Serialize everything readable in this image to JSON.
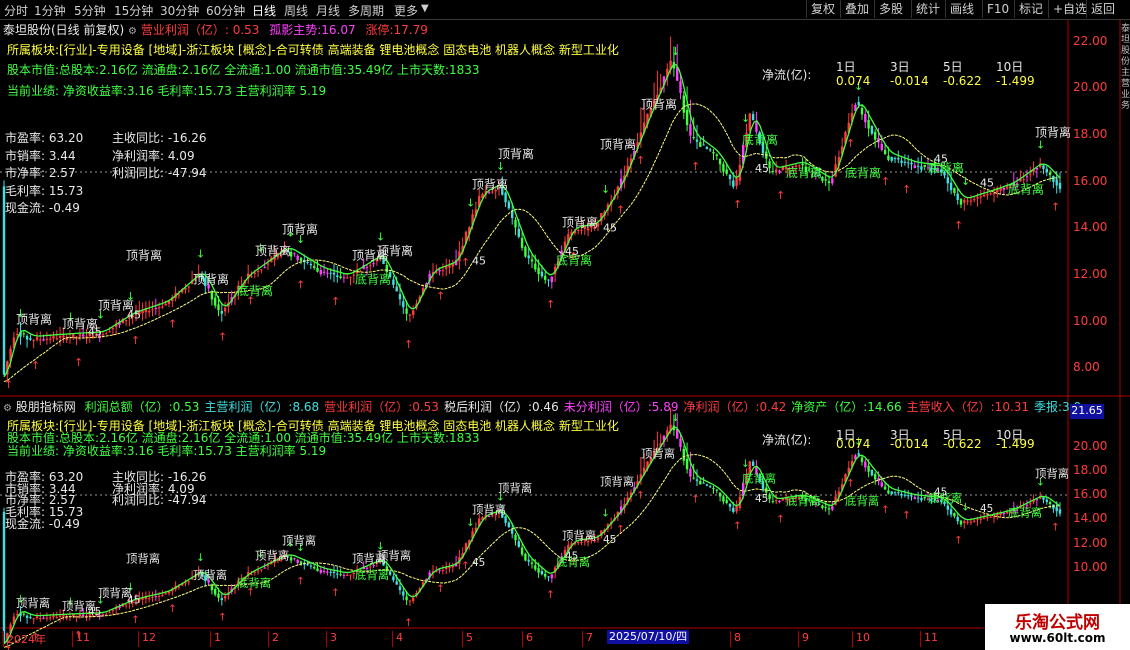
{
  "toolbar": {
    "periods": [
      "分时",
      "1分钟",
      "5分钟",
      "15分钟",
      "30分钟",
      "60分钟",
      "日线",
      "周线",
      "月线",
      "多周期",
      "更多"
    ],
    "active": "日线",
    "right_buttons": [
      "复权",
      "叠加",
      "多股",
      "统计",
      "画线",
      "F10",
      "标记",
      "+自选",
      "返回"
    ]
  },
  "top_header": {
    "title": "泰坦股份(日线 前复权)",
    "indicator1_label": "营业利润（亿）:",
    "indicator1_value": "0.53",
    "indicator2": "孤影主势:16.07",
    "indicator3": "涨停:17.79"
  },
  "info": {
    "sector_line": "所属板块:[行业]-专用设备 [地域]-浙江板块 [概念]-合可转债 高端装备 锂电池概念 固态电池 机器人概念 新型工业化",
    "capital_line": "股本市值:总股本:2.16亿 流通盘:2.16亿 全流通:1.00 流通市值:35.49亿 上市天数:1833",
    "perf_line": "当前业绩: 净资收益率:3.16 毛利率:15.73 主营利润率 5.19"
  },
  "metrics_left": [
    "市盈率: 63.20",
    "市销率: 3.44",
    "市净率: 2.57",
    "毛利率: 15.73",
    "现金流: -0.49"
  ],
  "metrics_right": [
    "主收同比: -16.26",
    "净利润率: 4.09",
    "利润同比: -47.94"
  ],
  "netflow": {
    "label": "净流(亿):",
    "headers": [
      "1日",
      "3日",
      "5日",
      "10日"
    ],
    "values": [
      "0.074",
      "-0.014",
      "-0.622",
      "-1.499"
    ]
  },
  "top_yaxis": [
    "22.00",
    "20.00",
    "18.00",
    "16.00",
    "14.00",
    "12.00",
    "10.00",
    "8.00"
  ],
  "bottom_yaxis": [
    "20.00",
    "18.00",
    "16.00",
    "14.00",
    "12.00",
    "10.00"
  ],
  "bottom_header": {
    "title": "股朋指标网",
    "items": [
      {
        "t": "利润总额（亿）:0.53",
        "c": "#40ff40"
      },
      {
        "t": "主营利润（亿）:8.68",
        "c": "#40e0e0"
      },
      {
        "t": "营业利润（亿）:0.53",
        "c": "#ff3c3c"
      },
      {
        "t": "税后利润（亿）:0.46",
        "c": "#e8e8e8"
      },
      {
        "t": "未分利润（亿）:5.89",
        "c": "#ff40ff"
      },
      {
        "t": "净利润（亿）:0.42",
        "c": "#ff3c3c"
      },
      {
        "t": "净资产（亿）:14.66",
        "c": "#40ff40"
      },
      {
        "t": "主营收入（亿）:10.31",
        "c": "#ff3c3c"
      },
      {
        "t": "季报:3.0",
        "c": "#40e0e0"
      }
    ],
    "price_box": "21.65"
  },
  "chart_labels": {
    "top_divergence": "顶背离",
    "bottom_divergence": "底背离",
    "angle": "45"
  },
  "xaxis": {
    "labels": [
      "2024年",
      "11",
      "12",
      "1",
      "2",
      "3",
      "4",
      "5",
      "6",
      "7",
      "8",
      "9",
      "10",
      "11",
      "12"
    ],
    "cursor_date": "2025/07/10/四"
  },
  "right_strip": "泰坦股份主营业务",
  "watermark": {
    "line1": "乐淘公式网",
    "line2": "www.60lt.com"
  },
  "colors": {
    "up": "#ff3c3c",
    "down": "#40ff40",
    "ma": "#ffff80",
    "bg": "#000000",
    "axis": "#ff3c3c"
  }
}
